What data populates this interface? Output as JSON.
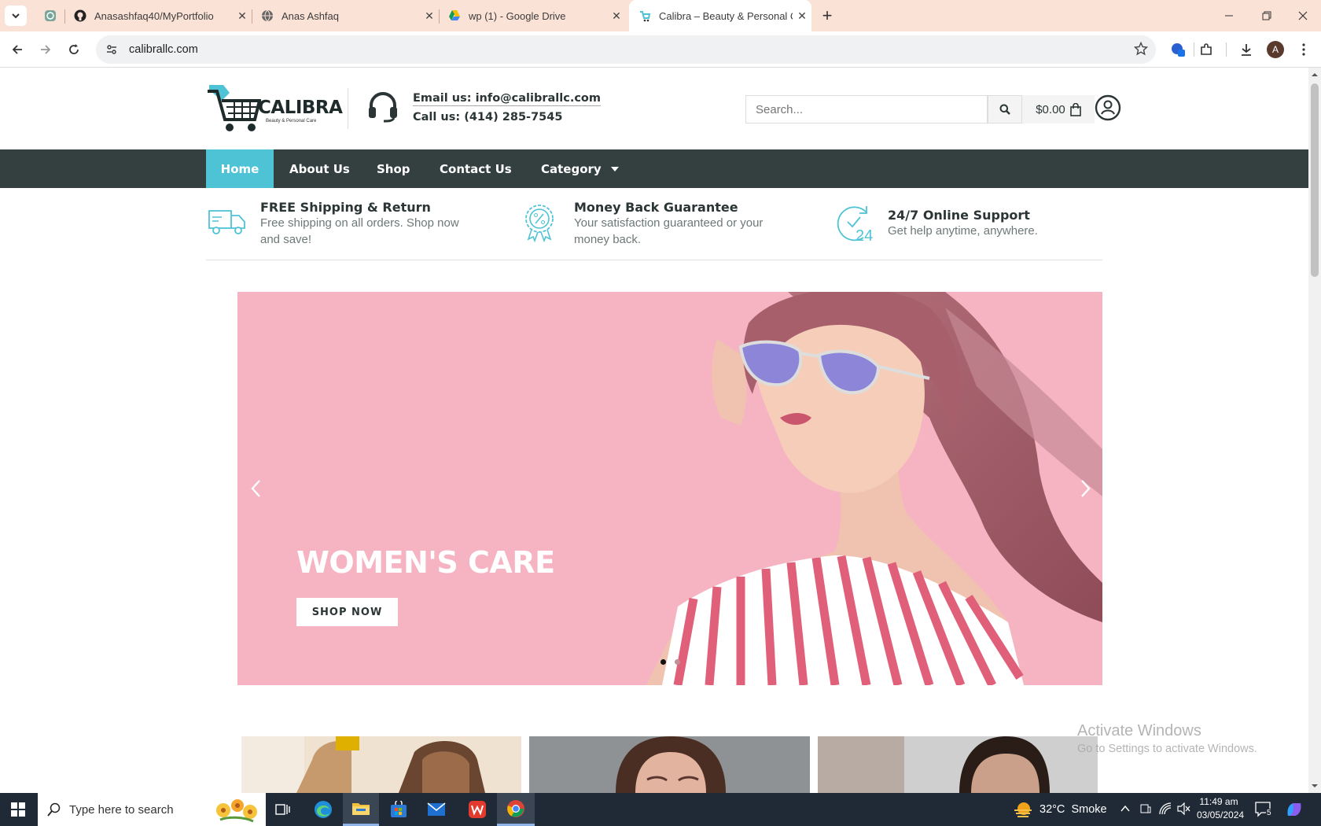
{
  "browser": {
    "tabs": [
      {
        "title": "",
        "icon": "chatgpt-icon"
      },
      {
        "title": "Anasashfaq40/MyPortfolio",
        "icon": "github-icon"
      },
      {
        "title": "Anas Ashfaq",
        "icon": "globe-icon"
      },
      {
        "title": "wp (1) - Google Drive",
        "icon": "google-drive-icon"
      },
      {
        "title": "Calibra – Beauty & Personal Care",
        "icon": "calibra-icon",
        "active": true
      }
    ],
    "url": "calibrallc.com",
    "profile_initial": "A"
  },
  "site": {
    "logo_name": "CALIBRA",
    "logo_tagline": "Beauty & Personal Care",
    "email": "Email us: info@calibrallc.com",
    "phone": "Call us: (414) 285-7545",
    "search_placeholder": "Search...",
    "cart_total": "$0.00",
    "nav": [
      "Home",
      "About Us",
      "Shop",
      "Contact Us",
      "Category"
    ],
    "features": [
      {
        "title": "FREE Shipping & Return",
        "text": "Free shipping on all orders. Shop now and save!",
        "icon": "truck-icon"
      },
      {
        "title": "Money Back Guarantee",
        "text": "Your satisfaction guaranteed or your money back.",
        "icon": "percent-badge-icon"
      },
      {
        "title": "24/7 Online Support",
        "text": "Get help anytime, anywhere.",
        "icon": "clock-24-icon"
      }
    ],
    "hero": {
      "heading": "WOMEN'S CARE",
      "button": "SHOP NOW",
      "slides": 2,
      "active_slide": 1
    }
  },
  "watermark": {
    "title": "Activate Windows",
    "text": "Go to Settings to activate Windows."
  },
  "taskbar": {
    "search_placeholder": "Type here to search",
    "weather": "32°C  Smoke",
    "time": "11:49 am",
    "date": "03/05/2024",
    "notifications": "5"
  },
  "colors": {
    "accent": "#4fc3d6",
    "nav_bg": "#344040",
    "hero_bg": "#f6b4c3",
    "tabstrip_bg": "#fbe2d6"
  }
}
